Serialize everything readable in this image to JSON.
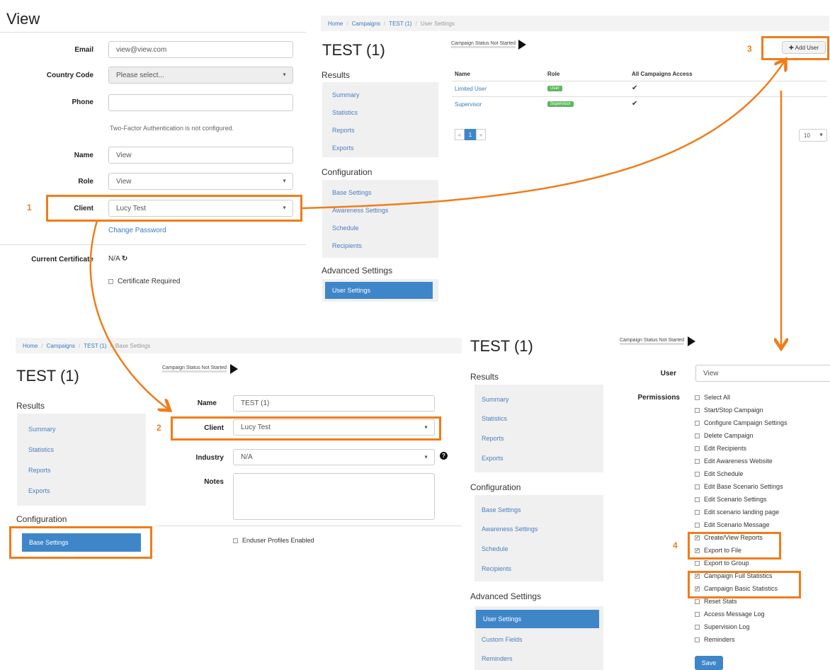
{
  "panel1": {
    "title": "View",
    "email_label": "Email",
    "email_value": "view@view.com",
    "country_label": "Country Code",
    "country_value": "Please select...",
    "phone_label": "Phone",
    "phone_value": "",
    "twofa_text": "Two-Factor Authentication is not configured.",
    "name_label": "Name",
    "name_value": "View",
    "role_label": "Role",
    "role_value": "View",
    "client_label": "Client",
    "client_value": "Lucy Test",
    "change_password": "Change Password",
    "cert_label": "Current Certificate",
    "cert_value": "N/A",
    "cert_required": "Certificate Required"
  },
  "panel2": {
    "breadcrumb": [
      "Home",
      "Campaigns",
      "TEST (1)",
      "User Settings"
    ],
    "title": "TEST (1)",
    "status_text": "Campaign Status  Not Started",
    "add_user": "Add User",
    "results_label": "Results",
    "results_items": [
      "Summary",
      "Statistics",
      "Reports",
      "Exports"
    ],
    "config_label": "Configuration",
    "config_items": [
      "Base Settings",
      "Awareness Settings",
      "Schedule",
      "Recipients"
    ],
    "advanced_label": "Advanced Settings",
    "advanced_item": "User Settings",
    "table_headers": [
      "Name",
      "Role",
      "All Campaigns Access"
    ],
    "rows": [
      {
        "name": "Limited User",
        "role": "User",
        "access": "✔"
      },
      {
        "name": "Supervisor",
        "role": "Supervisor",
        "access": "✔"
      }
    ],
    "pager": [
      "«",
      "1",
      "»"
    ],
    "page_size": "10"
  },
  "panel3": {
    "breadcrumb": [
      "Home",
      "Campaigns",
      "TEST (1)",
      "Base Settings"
    ],
    "title": "TEST (1)",
    "status_text": "Campaign Status  Not Started",
    "results_label": "Results",
    "results_items": [
      "Summary",
      "Statistics",
      "Reports",
      "Exports"
    ],
    "config_label": "Configuration",
    "config_item": "Base Settings",
    "name_label": "Name",
    "name_value": "TEST (1)",
    "client_label": "Client",
    "client_value": "Lucy Test",
    "industry_label": "Industry",
    "industry_value": "N/A",
    "notes_label": "Notes",
    "enduser_label": "Enduser Profiles Enabled"
  },
  "panel4": {
    "title": "TEST (1)",
    "status_text": "Campaign Status  Not Started",
    "results_label": "Results",
    "results_items": [
      "Summary",
      "Statistics",
      "Reports",
      "Exports"
    ],
    "config_label": "Configuration",
    "config_items": [
      "Base Settings",
      "Awareness Settings",
      "Schedule",
      "Recipients"
    ],
    "advanced_label": "Advanced Settings",
    "advanced_items": [
      "User Settings",
      "Custom Fields",
      "Reminders"
    ],
    "user_label": "User",
    "user_value": "View",
    "permissions_label": "Permissions",
    "permissions": [
      {
        "label": "Select All",
        "checked": false
      },
      {
        "label": "Start/Stop Campaign",
        "checked": false
      },
      {
        "label": "Configure Campaign Settings",
        "checked": false
      },
      {
        "label": "Delete Campaign",
        "checked": false
      },
      {
        "label": "Edit Recipients",
        "checked": false
      },
      {
        "label": "Edit Awareness Website",
        "checked": false
      },
      {
        "label": "Edit Schedule",
        "checked": false
      },
      {
        "label": "Edit Base Scenario Settings",
        "checked": false
      },
      {
        "label": "Edit Scenario Settings",
        "checked": false
      },
      {
        "label": "Edit scenario landing page",
        "checked": false
      },
      {
        "label": "Edit Scenario Message",
        "checked": false
      },
      {
        "label": "Create/View Reports",
        "checked": true
      },
      {
        "label": "Export to File",
        "checked": true
      },
      {
        "label": "Export to Group",
        "checked": false
      },
      {
        "label": "Campaign Full Statistics",
        "checked": true
      },
      {
        "label": "Campaign Basic Statistics",
        "checked": true
      },
      {
        "label": "Reset Stats",
        "checked": false
      },
      {
        "label": "Access Message Log",
        "checked": false
      },
      {
        "label": "Supervision Log",
        "checked": false
      },
      {
        "label": "Reminders",
        "checked": false
      }
    ],
    "save": "Save"
  },
  "annotations": [
    "1",
    "2",
    "3",
    "4"
  ],
  "colors": {
    "highlight": "#f07c1a",
    "primary": "#3f86c9",
    "link": "#3a7bbf",
    "badge": "#5cb85c"
  }
}
